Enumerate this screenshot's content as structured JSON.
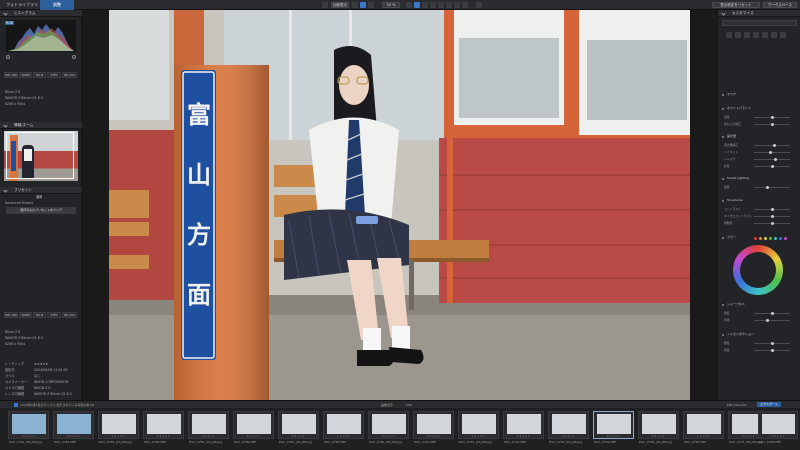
{
  "topbar": {
    "tabs": [
      "フォトライブラリ",
      "調整"
    ],
    "compare_label": "比較表示",
    "zoom_label": "50 %",
    "right_buttons": [
      "表示設定をリセット",
      "ワークスペース"
    ]
  },
  "left": {
    "histogram_title": "ヒストグラム",
    "info_title": "情報/ズーム",
    "presets_title": "プリセット",
    "presets_header": "適用",
    "advanced_history": "Advanced History",
    "preset_button": "選択済みのプリセットをクリア",
    "exif_iso": "ISO 100",
    "exif_shutter": "1/200",
    "exif_aperture": "f/2.8",
    "exif_ev": "0 EV",
    "exif_focal": "85 mm",
    "camera_model": "Nikon Z 8",
    "lens_model": "NIKKOR Z 85mm f/1.8 S",
    "file_size": "8256 x 5504",
    "metadata_rows": [
      "レーティング",
      "撮影日",
      "ラベル",
      "カメラメーカー",
      "カメラの機種",
      "レンズの機種"
    ],
    "metadata_values": [
      "★★★★★",
      "2024/06/08 12:24:45",
      "なし",
      "NIKON CORPORATION",
      "NIKON Z 8",
      "NIKKOR Z 85mm f/1.8 S"
    ]
  },
  "photo": {
    "sign_text": [
      "富",
      "山",
      "方",
      "面"
    ]
  },
  "right": {
    "panel_title": "カスタマイズ",
    "sections": [
      "マスク",
      "ホワイトバランス",
      "露光量",
      "ToneCurve",
      "カラー",
      "Smart Lighting",
      "シャープネス",
      "ノイズリダクション"
    ],
    "slider_labels": [
      "温度",
      "色かぶり補正",
      "露光量補正",
      "ハイライト",
      "シャドウ",
      "彩度",
      "自然な彩度",
      "コントラスト",
      "マイクロコントラスト",
      "明瞭度",
      "強度",
      "半径",
      "輝度",
      "色度"
    ]
  },
  "status": {
    "selection_text": "2024年6月8日のサンプル 表示されている写真の数 66",
    "count": "1/66",
    "center_label": "画像表示",
    "right_labels": [
      "MB Collection",
      "エクスポート"
    ]
  },
  "filmstrip": {
    "names": [
      "DSC_0781_(M)_RB.jpg",
      "DSC_0782.NEF",
      "DSC_0783_(M)_RB.jpg",
      "DSC_0784.NEF",
      "DSC_0785_(M)_RB.jpg",
      "DSC_0786.NEF",
      "DSC_0787_(M)_RB.jpg",
      "DSC_0788.NEF",
      "DSC_0789_(M)_RB.jpg",
      "DSC_0790.NEF",
      "DSC_0791_(M)_RB.jpg",
      "DSC_0792.NEF",
      "DSC_0793_(M)_RB.jpg",
      "DSC_0794.NEF",
      "DSC_0795_(M)_RB.jpg",
      "DSC_0796.NEF",
      "DSC_0797_(M)_RB.jpg",
      "DSC_0798.NEF"
    ],
    "stars": "★★★★★"
  },
  "colors": {
    "accent": "#2d5f9c",
    "wall_red": "#b94a45",
    "sign_blue": "#1f4f9f"
  }
}
